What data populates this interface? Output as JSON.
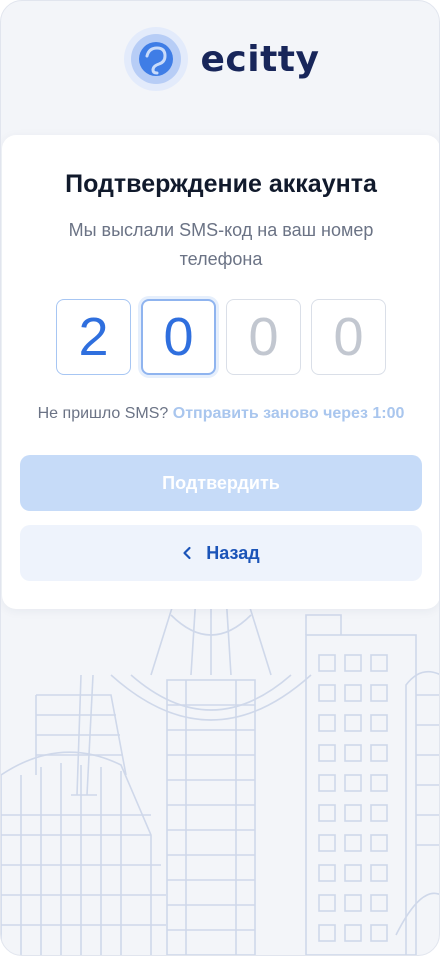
{
  "brand": {
    "name": "ecitty"
  },
  "verify": {
    "title": "Подтверждение аккаунта",
    "subtitle": "Мы выслали SMS-код на ваш номер телефона",
    "code_digits": [
      "2",
      "0",
      "0",
      "0"
    ],
    "resend_prompt": "Не пришло SMS?",
    "resend_link": "Отправить заново через 1:00",
    "confirm_label": "Подтвердить",
    "back_label": "Назад"
  },
  "colors": {
    "brand_navy": "#18265a",
    "accent_blue": "#2f6fde",
    "button_disabled": "#c6dbf8",
    "button_secondary_bg": "#eef3fc"
  }
}
